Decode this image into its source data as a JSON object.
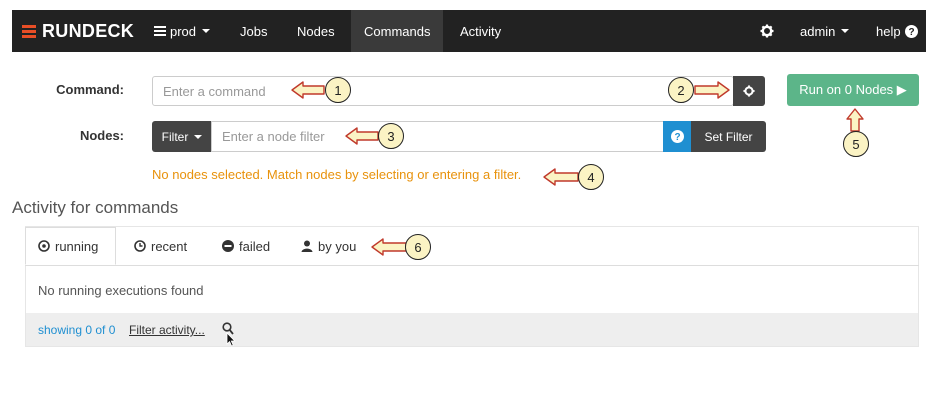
{
  "navbar": {
    "brand": "RUNDECK",
    "project": "prod",
    "items": [
      {
        "label": "Jobs"
      },
      {
        "label": "Nodes"
      },
      {
        "label": "Commands"
      },
      {
        "label": "Activity"
      }
    ],
    "user": "admin",
    "help": "help"
  },
  "command": {
    "label": "Command:",
    "placeholder": "Enter a command",
    "run_button": "Run on 0 Nodes ▶"
  },
  "nodes": {
    "label": "Nodes:",
    "filter_button": "Filter",
    "placeholder": "Enter a node filter",
    "set_filter_button": "Set Filter",
    "warning": "No nodes selected. Match nodes by selecting or entering a filter."
  },
  "activity": {
    "title": "Activity for commands",
    "tabs": [
      {
        "label": "running"
      },
      {
        "label": "recent"
      },
      {
        "label": "failed"
      },
      {
        "label": "by you"
      }
    ],
    "empty_message": "No running executions found",
    "showing": "showing 0 of 0",
    "filter_link": "Filter activity..."
  },
  "callouts": [
    "1",
    "2",
    "3",
    "4",
    "5",
    "6"
  ],
  "colors": {
    "navbar": "#222222",
    "brand_accent": "#e84e26",
    "run_button": "#5cb589",
    "warning": "#e8920c",
    "help_button": "#1f8fd1",
    "callout_fill": "#fbf3c4"
  }
}
